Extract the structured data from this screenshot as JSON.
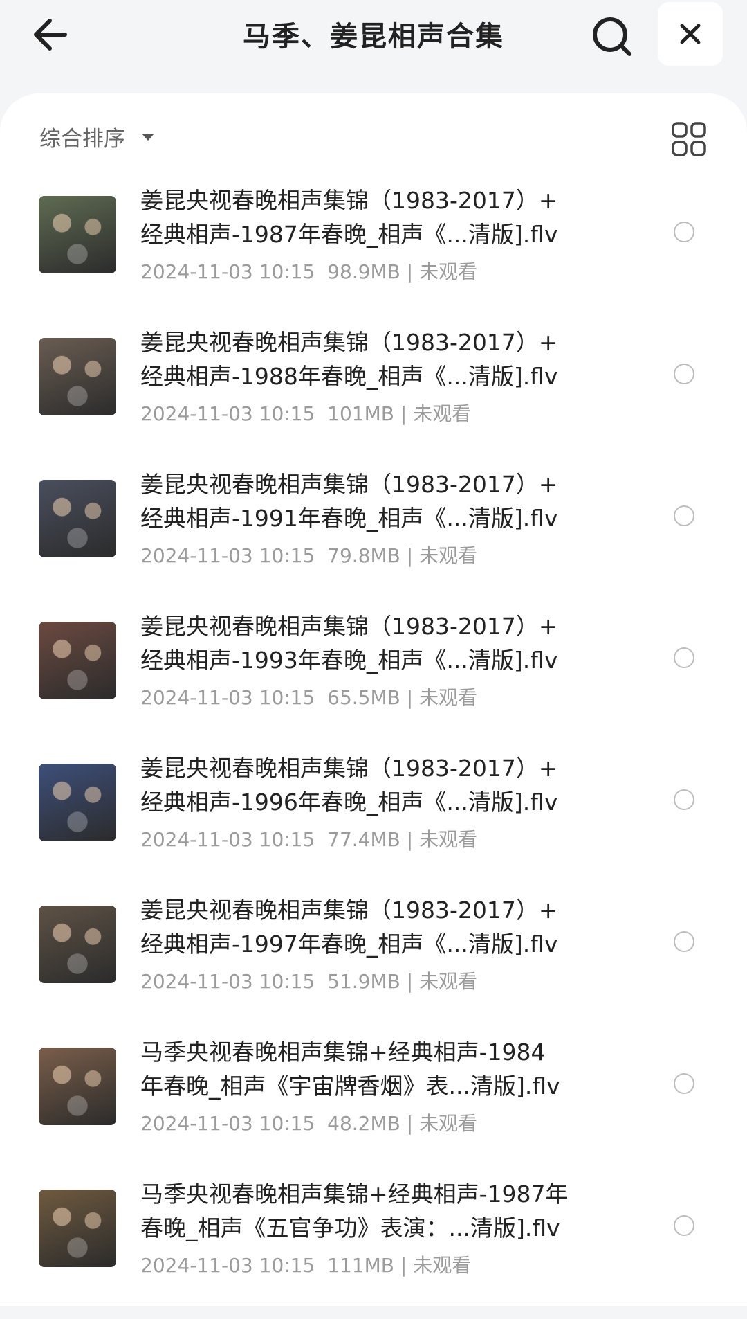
{
  "header": {
    "title": "马季、姜昆相声合集",
    "back_icon": "arrow-left-icon",
    "search_icon": "search-icon",
    "close_icon": "close-icon"
  },
  "toolbar": {
    "sort_label": "综合排序",
    "grid_icon": "grid-view-icon"
  },
  "files": [
    {
      "title_line1": "姜昆央视春晚相声集锦（1983-2017）+",
      "title_line2": "经典相声-1987年春晚_相声《...清版].flv",
      "date": "2024-11-03 10:15",
      "size": "98.9MB",
      "status": "未观看"
    },
    {
      "title_line1": "姜昆央视春晚相声集锦（1983-2017）+",
      "title_line2": "经典相声-1988年春晚_相声《...清版].flv",
      "date": "2024-11-03 10:15",
      "size": "101MB",
      "status": "未观看"
    },
    {
      "title_line1": "姜昆央视春晚相声集锦（1983-2017）+",
      "title_line2": "经典相声-1991年春晚_相声《...清版].flv",
      "date": "2024-11-03 10:15",
      "size": "79.8MB",
      "status": "未观看"
    },
    {
      "title_line1": "姜昆央视春晚相声集锦（1983-2017）+",
      "title_line2": "经典相声-1993年春晚_相声《...清版].flv",
      "date": "2024-11-03 10:15",
      "size": "65.5MB",
      "status": "未观看"
    },
    {
      "title_line1": "姜昆央视春晚相声集锦（1983-2017）+",
      "title_line2": "经典相声-1996年春晚_相声《...清版].flv",
      "date": "2024-11-03 10:15",
      "size": "77.4MB",
      "status": "未观看"
    },
    {
      "title_line1": "姜昆央视春晚相声集锦（1983-2017）+",
      "title_line2": "经典相声-1997年春晚_相声《...清版].flv",
      "date": "2024-11-03 10:15",
      "size": "51.9MB",
      "status": "未观看"
    },
    {
      "title_line1": "马季央视春晚相声集锦+经典相声-1984",
      "title_line2": "年春晚_相声《宇宙牌香烟》表...清版].flv",
      "date": "2024-11-03 10:15",
      "size": "48.2MB",
      "status": "未观看"
    },
    {
      "title_line1": "马季央视春晚相声集锦+经典相声-1987年",
      "title_line2": "春晚_相声《五官争功》表演：...清版].flv",
      "date": "2024-11-03 10:15",
      "size": "111MB",
      "status": "未观看"
    }
  ],
  "thumb_colors": [
    "#5f6b52",
    "#6a5d52",
    "#4a4f5e",
    "#6b4a40",
    "#3d4f7a",
    "#5e5245",
    "#7a5e4a",
    "#6f5a3f"
  ]
}
